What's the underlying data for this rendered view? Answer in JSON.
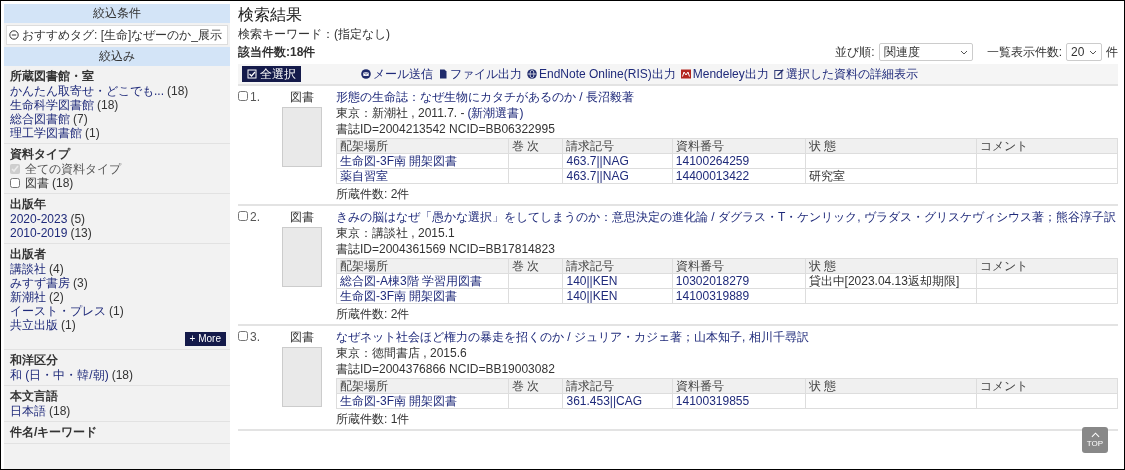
{
  "sidebar": {
    "conditions_header": "絞込条件",
    "active_tag": "おすすめタグ: [生命]なぜーのか_展示",
    "refine_header": "絞込み",
    "facets": [
      {
        "title": "所蔵図書館・室",
        "items": [
          {
            "kind": "link",
            "label": "かんたん取寄せ・どこでも...",
            "count": "(18)"
          },
          {
            "kind": "link",
            "label": "生命科学図書館",
            "count": "(18)"
          },
          {
            "kind": "link",
            "label": "総合図書館",
            "count": "(7)"
          },
          {
            "kind": "link",
            "label": "理工学図書館",
            "count": "(1)"
          }
        ]
      },
      {
        "title": "資料タイプ",
        "items": [
          {
            "kind": "checkbox",
            "label": "全ての資料タイプ",
            "checked": true,
            "disabled": true
          },
          {
            "kind": "checkbox",
            "label": "図書",
            "count": "(18)",
            "checked": false,
            "disabled": false
          }
        ]
      },
      {
        "title": "出版年",
        "items": [
          {
            "kind": "link",
            "label": "2020-2023",
            "count": "(5)"
          },
          {
            "kind": "link",
            "label": "2010-2019",
            "count": "(13)"
          }
        ]
      },
      {
        "title": "出版者",
        "more": "+ More",
        "items": [
          {
            "kind": "link",
            "label": "講談社",
            "count": "(4)"
          },
          {
            "kind": "link",
            "label": "みすず書房",
            "count": "(3)"
          },
          {
            "kind": "link",
            "label": "新潮社",
            "count": "(2)"
          },
          {
            "kind": "link",
            "label": "イースト・プレス",
            "count": "(1)"
          },
          {
            "kind": "link",
            "label": "共立出版",
            "count": "(1)"
          }
        ]
      },
      {
        "title": "和洋区分",
        "items": [
          {
            "kind": "link",
            "label": "和 (日・中・韓/朝)",
            "count": "(18)"
          }
        ]
      },
      {
        "title": "本文言語",
        "items": [
          {
            "kind": "link",
            "label": "日本語",
            "count": "(18)"
          }
        ]
      },
      {
        "title": "件名/キーワード"
      }
    ]
  },
  "main": {
    "title": "検索結果",
    "keyword": "検索キーワード：(指定なし)",
    "hit_count": "該当件数:18件",
    "sort_label": "並び順:",
    "sort_value": "関連度",
    "per_page_label": "一覧表示件数:",
    "per_page_value": "20",
    "per_page_unit": "件"
  },
  "toolbar": {
    "select_all": "全選択",
    "actions": [
      {
        "kind": "mail",
        "label": "メール送信"
      },
      {
        "kind": "file",
        "label": "ファイル出力"
      },
      {
        "kind": "endnote",
        "label": "EndNote Online(RIS)出力"
      },
      {
        "kind": "mendeley",
        "label": "Mendeley出力"
      },
      {
        "kind": "edit",
        "label": "選択した資料の詳細表示"
      }
    ]
  },
  "results": [
    {
      "number": "1.",
      "checked": false,
      "material_type": "図書",
      "title": "形態の生命誌：なぜ生物にカタチがあるのか / 長沼毅著",
      "publication": "東京：新潮社 , 2011.7. -",
      "series": "(新潮選書)",
      "ids": "書誌ID=2004213542 NCID=BB06322995",
      "holding_columns": [
        "配架場所",
        "巻 次",
        "請求記号",
        "資料番号",
        "状 態",
        "コメント"
      ],
      "holdings": [
        {
          "location": "生命図-3F南 開架図書",
          "call_number": "463.7||NAG",
          "item_number": "14100264259"
        },
        {
          "location": "薬自習室",
          "call_number": "463.7||NAG",
          "item_number": "14400013422",
          "status": "研究室"
        }
      ],
      "holdings_count": "所蔵件数: 2件"
    },
    {
      "number": "2.",
      "checked": false,
      "material_type": "図書",
      "title": "きみの脳はなぜ「愚かな選択」をしてしまうのか：意思決定の進化論 / ダグラス・T・ケンリック, ヴラダス・グリスケヴィシウス著；熊谷淳子訳",
      "publication": "東京：講談社 , 2015.1",
      "ids": "書誌ID=2004361569 NCID=BB17814823",
      "holding_columns": [
        "配架場所",
        "巻 次",
        "請求記号",
        "資料番号",
        "状 態",
        "コメント"
      ],
      "holdings": [
        {
          "location": "総合図-A棟3階 学習用図書",
          "call_number": "140||KEN",
          "item_number": "10302018279",
          "status": "貸出中[2023.04.13返却期限]"
        },
        {
          "location": "生命図-3F南 開架図書",
          "call_number": "140||KEN",
          "item_number": "14100319889"
        }
      ],
      "holdings_count": "所蔵件数: 2件"
    },
    {
      "number": "3.",
      "checked": false,
      "material_type": "図書",
      "title": "なぜネット社会ほど権力の暴走を招くのか / ジュリア・カジェ著；山本知子, 相川千尋訳",
      "publication": "東京：徳間書店 , 2015.6",
      "ids": "書誌ID=2004376866 NCID=BB19003082",
      "holding_columns": [
        "配架場所",
        "巻 次",
        "請求記号",
        "資料番号",
        "状 態",
        "コメント"
      ],
      "holdings": [
        {
          "location": "生命図-3F南 開架図書",
          "call_number": "361.453||CAG",
          "item_number": "14100319855"
        }
      ],
      "holdings_count": "所蔵件数: 1件"
    }
  ],
  "top_button": "TOP"
}
